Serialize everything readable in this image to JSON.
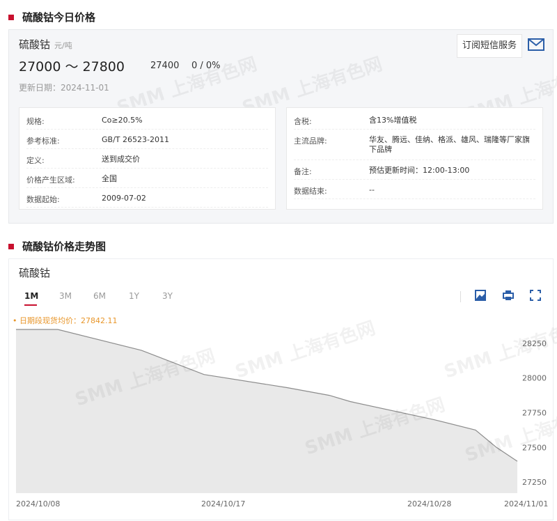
{
  "section1": {
    "title": "硫酸钴今日价格"
  },
  "product": {
    "name": "硫酸钴",
    "unit": "元/吨",
    "range": "27000 ～ 27800",
    "avg": "27400",
    "change": "0 / 0%",
    "update_label": "更新日期：",
    "update_date": "2024-11-01",
    "subscribe_label": "订阅短信服务",
    "mail_icon": "mail-icon"
  },
  "specs_left": [
    {
      "k": "规格:",
      "v": "Co≥20.5%"
    },
    {
      "k": "参考标准:",
      "v": "GB/T 26523-2011"
    },
    {
      "k": "定义:",
      "v": "送到成交价"
    },
    {
      "k": "价格产生区域:",
      "v": "全国"
    },
    {
      "k": "数据起始:",
      "v": "2009-07-02"
    }
  ],
  "specs_right": [
    {
      "k": "含税:",
      "v": "含13%增值税"
    },
    {
      "k": "主流品牌:",
      "v": "华友、腾远、佳纳、格派、雄风、瑞隆等厂家旗下品牌"
    },
    {
      "k": "备注:",
      "v": "预估更新时间：12:00-13:00"
    },
    {
      "k": "数据结束:",
      "v": "--"
    }
  ],
  "section2": {
    "title": "硫酸钴价格走势图"
  },
  "chart_panel": {
    "title": "硫酸钴",
    "tabs": [
      "1M",
      "3M",
      "6M",
      "1Y",
      "3Y"
    ],
    "active_tab": "1M",
    "avg_label": "• 日期段现货均价：27842.11",
    "tools": [
      "image-download-icon",
      "print-icon",
      "fullscreen-icon"
    ]
  },
  "watermark": {
    "text": "SMM 上海有色网"
  },
  "chart_data": {
    "type": "area",
    "x": [
      "2024/10/08",
      "2024/10/10",
      "2024/10/14",
      "2024/10/17",
      "2024/10/21",
      "2024/10/23",
      "2024/10/24",
      "2024/10/28",
      "2024/10/30",
      "2024/10/31",
      "2024/11/01"
    ],
    "values": [
      28350,
      28350,
      28200,
      28025,
      27930,
      27875,
      27830,
      27700,
      27625,
      27500,
      27400
    ],
    "xticks": [
      "2024/10/08",
      "2024/10/17",
      "2024/10/28",
      "2024/11/01"
    ],
    "yticks": [
      27250,
      27500,
      27750,
      28000,
      28250
    ],
    "ylim": [
      27170,
      28370
    ],
    "colors": {
      "line": "#8c8c8c",
      "fill": "#e9e9e9"
    }
  }
}
